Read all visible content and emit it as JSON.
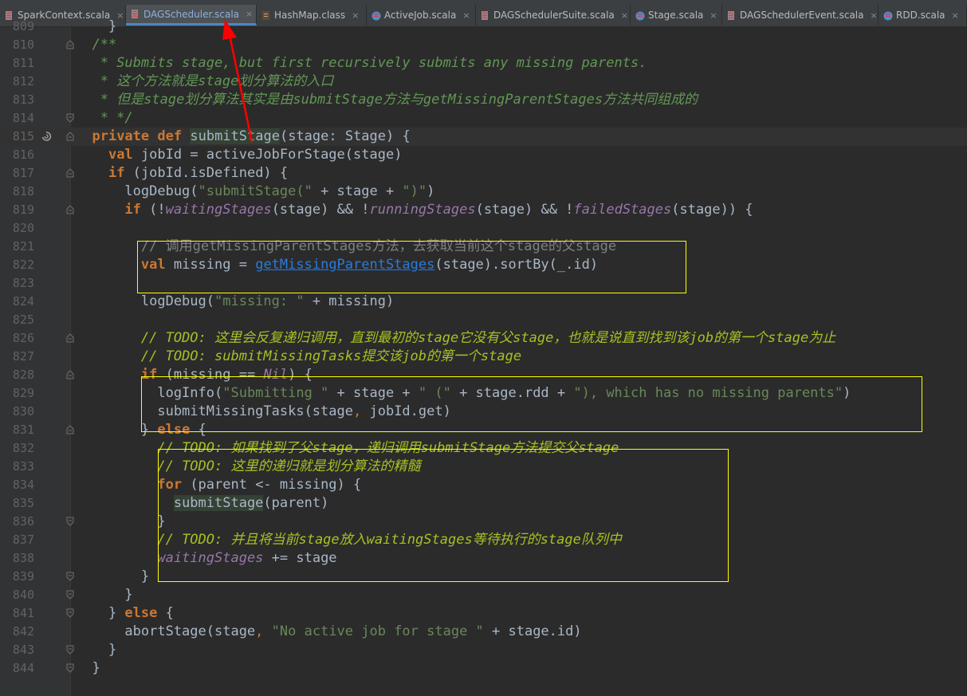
{
  "tabs": [
    {
      "label": "SparkContext.scala",
      "icon": "scala-object-icon",
      "active": false
    },
    {
      "label": "DAGScheduler.scala",
      "icon": "scala-object-icon",
      "active": true
    },
    {
      "label": "HashMap.class",
      "icon": "class-file-icon",
      "active": false
    },
    {
      "label": "ActiveJob.scala",
      "icon": "scala-class-icon",
      "active": false
    },
    {
      "label": "DAGSchedulerSuite.scala",
      "icon": "scala-object-icon",
      "active": false
    },
    {
      "label": "Stage.scala",
      "icon": "scala-class-icon",
      "active": false
    },
    {
      "label": "DAGSchedulerEvent.scala",
      "icon": "scala-object-icon",
      "active": false
    },
    {
      "label": "RDD.scala",
      "icon": "scala-class-icon",
      "active": false
    }
  ],
  "tab_close": "×",
  "lines": [
    {
      "n": "809",
      "tokens": [
        [
          "p",
          "    }"
        ]
      ]
    },
    {
      "n": "810",
      "tokens": [
        [
          "d",
          "  /**"
        ]
      ]
    },
    {
      "n": "811",
      "tokens": [
        [
          "d",
          "   * Submits stage, but first recursively submits any missing parents."
        ]
      ]
    },
    {
      "n": "812",
      "tokens": [
        [
          "d",
          "   * 这个方法就是stage划分算法的入口"
        ]
      ]
    },
    {
      "n": "813",
      "tokens": [
        [
          "d",
          "   * 但是stage划分算法其实是由submitStage方法与getMissingParentStages方法共同组成的"
        ]
      ]
    },
    {
      "n": "814",
      "tokens": [
        [
          "d",
          "   * */"
        ]
      ]
    },
    {
      "n": "815",
      "tokens": [
        [
          "p",
          "  "
        ],
        [
          "k",
          "private"
        ],
        [
          "p",
          " "
        ],
        [
          "k",
          "def"
        ],
        [
          "p",
          " "
        ],
        [
          "hd",
          "submitStage"
        ],
        [
          "p",
          "(stage: Stage) {"
        ]
      ]
    },
    {
      "n": "816",
      "tokens": [
        [
          "p",
          "    "
        ],
        [
          "k",
          "val"
        ],
        [
          "p",
          " jobId = activeJobForStage(stage)"
        ]
      ]
    },
    {
      "n": "817",
      "tokens": [
        [
          "p",
          "    "
        ],
        [
          "k",
          "if"
        ],
        [
          "p",
          " (jobId.isDefined) {"
        ]
      ]
    },
    {
      "n": "818",
      "tokens": [
        [
          "p",
          "      logDebug("
        ],
        [
          "s",
          "\"submitStage(\""
        ],
        [
          "p",
          " + stage + "
        ],
        [
          "s",
          "\")\""
        ],
        [
          "p",
          ")"
        ]
      ]
    },
    {
      "n": "819",
      "tokens": [
        [
          "p",
          "      "
        ],
        [
          "k",
          "if"
        ],
        [
          "p",
          " (!"
        ],
        [
          "f",
          "waitingStages"
        ],
        [
          "p",
          "(stage) && !"
        ],
        [
          "f",
          "runningStages"
        ],
        [
          "p",
          "(stage) && !"
        ],
        [
          "f",
          "failedStages"
        ],
        [
          "p",
          "(stage)) {"
        ]
      ]
    },
    {
      "n": "820",
      "tokens": []
    },
    {
      "n": "821",
      "tokens": [
        [
          "p",
          "        "
        ],
        [
          "c",
          "// 调用getMissingParentStages方法，去获取当前这个stage的父stage"
        ]
      ]
    },
    {
      "n": "822",
      "tokens": [
        [
          "p",
          "        "
        ],
        [
          "k",
          "val"
        ],
        [
          "p",
          " missing = "
        ],
        [
          "l",
          "getMissingParentStages"
        ],
        [
          "p",
          "(stage).sortBy(_.id)"
        ]
      ]
    },
    {
      "n": "823",
      "tokens": []
    },
    {
      "n": "824",
      "tokens": [
        [
          "p",
          "        logDebug("
        ],
        [
          "s",
          "\"missing: \""
        ],
        [
          "p",
          " + missing)"
        ]
      ]
    },
    {
      "n": "825",
      "tokens": []
    },
    {
      "n": "826",
      "tokens": [
        [
          "p",
          "        "
        ],
        [
          "t",
          "// TODO: 这里会反复递归调用，直到最初的stage它没有父stage，也就是说直到找到该job的第一个stage为止"
        ]
      ]
    },
    {
      "n": "827",
      "tokens": [
        [
          "p",
          "        "
        ],
        [
          "t",
          "// TODO: submitMissingTasks提交该job的第一个stage"
        ]
      ]
    },
    {
      "n": "828",
      "tokens": [
        [
          "p",
          "        "
        ],
        [
          "k",
          "if"
        ],
        [
          "p",
          " (missing == "
        ],
        [
          "f",
          "Nil"
        ],
        [
          "p",
          ") {"
        ]
      ]
    },
    {
      "n": "829",
      "tokens": [
        [
          "p",
          "          logInfo("
        ],
        [
          "s",
          "\"Submitting \""
        ],
        [
          "p",
          " + stage + "
        ],
        [
          "s",
          "\" (\""
        ],
        [
          "p",
          " + stage.rdd + "
        ],
        [
          "s",
          "\"), which has no missing parents\""
        ],
        [
          "p",
          ")"
        ]
      ]
    },
    {
      "n": "830",
      "tokens": [
        [
          "p",
          "          submitMissingTasks(stage"
        ],
        [
          "o",
          ","
        ],
        [
          "p",
          " jobId.get)"
        ]
      ]
    },
    {
      "n": "831",
      "tokens": [
        [
          "p",
          "        } "
        ],
        [
          "k",
          "else"
        ],
        [
          "p",
          " {"
        ]
      ]
    },
    {
      "n": "832",
      "tokens": [
        [
          "p",
          "          "
        ],
        [
          "t",
          "// TODO: 如果找到了父stage，递归调用submitStage方法提交父stage"
        ]
      ]
    },
    {
      "n": "833",
      "tokens": [
        [
          "p",
          "          "
        ],
        [
          "t",
          "// TODO: 这里的递归就是划分算法的精髓"
        ]
      ]
    },
    {
      "n": "834",
      "tokens": [
        [
          "p",
          "          "
        ],
        [
          "k",
          "for"
        ],
        [
          "p",
          " (parent <- missing) {"
        ]
      ]
    },
    {
      "n": "835",
      "tokens": [
        [
          "p",
          "            "
        ],
        [
          "hu",
          "submitStage"
        ],
        [
          "p",
          "(parent)"
        ]
      ]
    },
    {
      "n": "836",
      "tokens": [
        [
          "p",
          "          }"
        ]
      ]
    },
    {
      "n": "837",
      "tokens": [
        [
          "p",
          "          "
        ],
        [
          "t",
          "// TODO: 并且将当前stage放入waitingStages等待执行的stage队列中"
        ]
      ]
    },
    {
      "n": "838",
      "tokens": [
        [
          "p",
          "          "
        ],
        [
          "f",
          "waitingStages"
        ],
        [
          "p",
          " += stage"
        ]
      ]
    },
    {
      "n": "839",
      "tokens": [
        [
          "p",
          "        }"
        ]
      ]
    },
    {
      "n": "840",
      "tokens": [
        [
          "p",
          "      }"
        ]
      ]
    },
    {
      "n": "841",
      "tokens": [
        [
          "p",
          "    } "
        ],
        [
          "k",
          "else"
        ],
        [
          "p",
          " {"
        ]
      ]
    },
    {
      "n": "842",
      "tokens": [
        [
          "p",
          "      abortStage(stage"
        ],
        [
          "o",
          ","
        ],
        [
          "p",
          " "
        ],
        [
          "s",
          "\"No active job for stage \""
        ],
        [
          "p",
          " + stage.id)"
        ]
      ]
    },
    {
      "n": "843",
      "tokens": [
        [
          "p",
          "    }"
        ]
      ]
    },
    {
      "n": "844",
      "tokens": [
        [
          "p",
          "  }"
        ]
      ]
    }
  ],
  "colors": {
    "highlight_box": "#ffff00",
    "annotation_arrow": "#ff0000"
  }
}
